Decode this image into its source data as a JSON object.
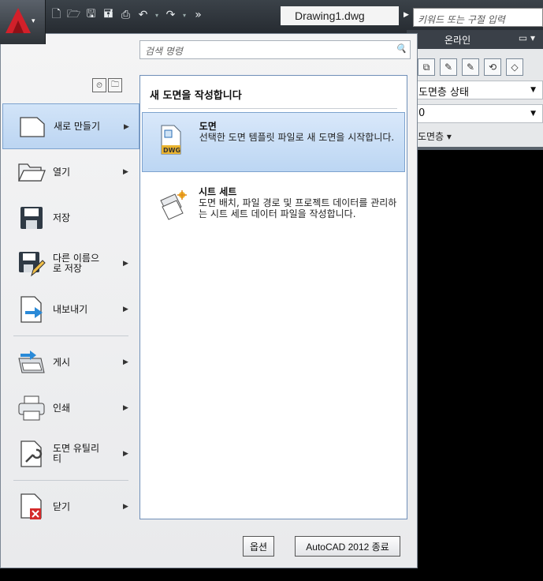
{
  "title_bar": {
    "document_title": "Drawing1.dwg",
    "search_placeholder": "키워드 또는 구절 입력"
  },
  "quick_access": {
    "icons": [
      "new-icon",
      "open-icon",
      "save-icon",
      "save-as-icon",
      "plot-icon",
      "undo-icon",
      "redo-icon",
      "more-icon"
    ]
  },
  "ribbon": {
    "tab_label": "온라인",
    "layer_state": "도면층 상태",
    "layer_value": "0",
    "panel_label": "도면층 ▾"
  },
  "menu": {
    "search_placeholder": "검색 명령",
    "left_items": [
      {
        "label": "새로 만들기",
        "icon": "new-document-icon",
        "has_sub": true
      },
      {
        "label": "열기",
        "icon": "open-folder-icon",
        "has_sub": true
      },
      {
        "label": "저장",
        "icon": "save-disk-icon",
        "has_sub": false
      },
      {
        "label": "다른 이름으로 저장",
        "icon": "save-as-pencil-icon",
        "has_sub": true
      },
      {
        "label": "내보내기",
        "icon": "export-arrow-icon",
        "has_sub": true
      },
      {
        "label": "게시",
        "icon": "publish-icon",
        "has_sub": true
      },
      {
        "label": "인쇄",
        "icon": "printer-icon",
        "has_sub": true
      },
      {
        "label": "도면 유틸리티",
        "icon": "wrench-utility-icon",
        "has_sub": true
      },
      {
        "label": "닫기",
        "icon": "close-document-icon",
        "has_sub": true
      }
    ],
    "submenu": {
      "title": "새 도면을 작성합니다",
      "options": [
        {
          "title": "도면",
          "desc": "선택한 도면 템플릿 파일로 새 도면을 시작합니다.",
          "icon": "dwg-file-icon"
        },
        {
          "title": "시트 세트",
          "desc": "도면 배치, 파일 경로 및 프로젝트 데이터를 관리하는 시트 세트 데이터 파일을 작성합니다.",
          "icon": "sheet-set-icon"
        }
      ]
    },
    "options_button": "옵션",
    "exit_button": "AutoCAD 2012 종료"
  }
}
